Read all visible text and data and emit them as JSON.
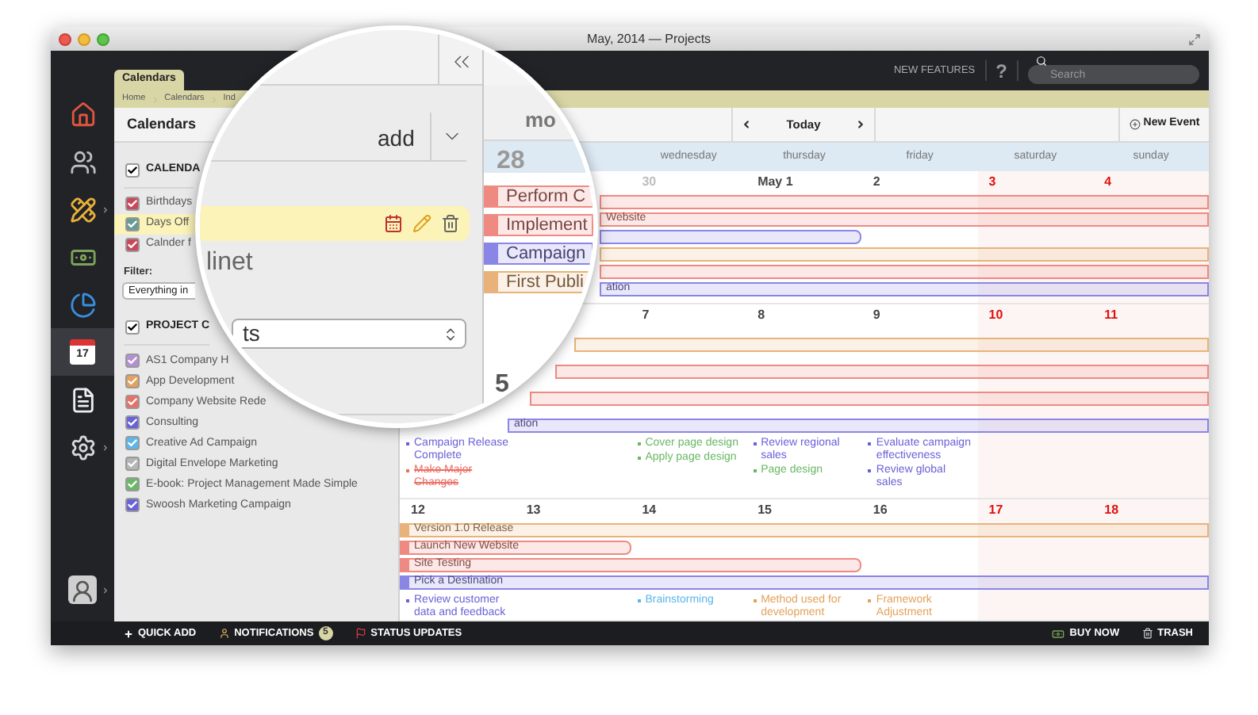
{
  "window": {
    "title": "May, 2014 — Projects"
  },
  "toolbar": {
    "new_features": "NEW FEATURES",
    "help": "?",
    "search": {
      "placeholder": "Search"
    }
  },
  "tabs": [
    {
      "label": "Calendars",
      "selected": true
    }
  ],
  "breadcrumb": [
    "Home",
    "Calendars",
    "Ind"
  ],
  "nav": [
    {
      "kind": "home",
      "selected": false,
      "has_menu": false
    },
    {
      "kind": "people",
      "selected": false,
      "has_menu": false
    },
    {
      "kind": "tools",
      "selected": false,
      "has_menu": true
    },
    {
      "kind": "money",
      "selected": false,
      "has_menu": false
    },
    {
      "kind": "chart",
      "selected": false,
      "has_menu": false
    },
    {
      "kind": "calendar",
      "selected": true,
      "has_menu": false,
      "label": "17"
    },
    {
      "kind": "document",
      "selected": false,
      "has_menu": false
    },
    {
      "kind": "settings",
      "selected": false,
      "has_menu": true
    }
  ],
  "user": {
    "has_menu": true
  },
  "panel": {
    "title": "Calendars",
    "calendars": {
      "title": "CALENDA",
      "checked": true,
      "items": [
        {
          "label": "Birthdays",
          "checked": true,
          "selected": false,
          "color": "#c9485b"
        },
        {
          "label": "Days Off",
          "checked": true,
          "selected": true,
          "color": "#6a9a96"
        },
        {
          "label": "Calnder f",
          "checked": true,
          "selected": false,
          "color": "#c9485b"
        }
      ]
    },
    "filter": {
      "label": "Filter:",
      "value": "Everything in"
    },
    "projects": {
      "title": "PROJECT C",
      "checked": true,
      "items": [
        {
          "label": "AS1 Company H",
          "checked": true,
          "color": "#b48fd6"
        },
        {
          "label": "App Development",
          "checked": true,
          "color": "#e4a15a"
        },
        {
          "label": "Company Website Rede",
          "checked": true,
          "color": "#ea6f66"
        },
        {
          "label": "Consulting",
          "checked": true,
          "color": "#6a62d8"
        },
        {
          "label": "Creative Ad Campaign",
          "checked": true,
          "color": "#5cb6ea"
        },
        {
          "label": "Digital Envelope Marketing",
          "checked": true,
          "color": "#b5b5b5"
        },
        {
          "label": "E-book: Project Management Made Simple",
          "checked": true,
          "color": "#6ab865"
        },
        {
          "label": "Swoosh Marketing Campaign",
          "checked": true,
          "color": "#6a62d8"
        }
      ]
    }
  },
  "calendar": {
    "today": "Today",
    "new_event": "New Event",
    "days": [
      {
        "label": "wednesday"
      },
      {
        "label": "thursday"
      },
      {
        "label": "friday"
      },
      {
        "label": "saturday"
      },
      {
        "label": "sunday"
      }
    ],
    "weeks": [
      {
        "cells": [
          {
            "date": "30",
            "weekend": false,
            "other_month": true
          },
          {
            "date": "May 1",
            "weekend": false,
            "other_month": false
          },
          {
            "date": "2",
            "weekend": false,
            "other_month": false
          },
          {
            "date": "3",
            "weekend": true,
            "other_month": false
          },
          {
            "date": "4",
            "weekend": true,
            "other_month": false
          }
        ],
        "events": [
          {
            "color": "#ee8a82",
            "kind": "full"
          },
          {
            "label": "Website",
            "color": "#ee8a82",
            "kind": "full"
          },
          {
            "color": "#8a86e6",
            "kind": "long"
          },
          {
            "color": "#e8b27a",
            "kind": "full"
          },
          {
            "color": "#ee8a82",
            "kind": "full"
          },
          {
            "label": "ation",
            "color": "#8a86e6",
            "kind": "full"
          }
        ]
      },
      {
        "cells": [
          {
            "weekend": false,
            "tasks": [
              {
                "text": "Campaign Release Complete",
                "color": "#6a62d8",
                "done": false
              },
              {
                "text": "Make Major Changes",
                "color": "#ea6f66",
                "done": true
              }
            ]
          },
          {
            "weekend": false
          },
          {
            "date": "7",
            "weekend": false,
            "other_month": false,
            "tasks": [
              {
                "text": "Cover page design",
                "color": "#6ab865",
                "done": false
              },
              {
                "text": "Apply page design",
                "color": "#6ab865",
                "done": false
              }
            ]
          },
          {
            "date": "8",
            "weekend": false,
            "other_month": false,
            "tasks": [
              {
                "text": "Review regional sales",
                "color": "#6a62d8",
                "done": false
              },
              {
                "text": "Page design",
                "color": "#6ab865",
                "done": false
              }
            ]
          },
          {
            "date": "9",
            "weekend": false,
            "other_month": false,
            "tasks": [
              {
                "text": "Evaluate campaign effectiveness",
                "color": "#6a62d8",
                "done": false
              },
              {
                "text": "Review global sales",
                "color": "#6a62d8",
                "done": false
              }
            ]
          },
          {
            "date": "10",
            "weekend": true,
            "other_month": false
          },
          {
            "date": "11",
            "weekend": true,
            "other_month": false
          }
        ],
        "events": [
          {
            "color": "#e8b27a",
            "kind": "full"
          },
          {
            "color": "#ee8a82",
            "kind": "full"
          },
          {
            "color": "#ee8a82",
            "kind": "full"
          },
          {
            "label": "ation",
            "color": "#8a86e6",
            "kind": "full"
          }
        ]
      },
      {
        "cells": [
          {
            "date": "12",
            "weekend": false,
            "other_month": false,
            "tasks": [
              {
                "text": "Review customer data and feedback",
                "color": "#6a62d8",
                "done": false
              }
            ]
          },
          {
            "date": "13",
            "weekend": false,
            "other_month": false
          },
          {
            "date": "14",
            "weekend": false,
            "other_month": false,
            "tasks": [
              {
                "text": "Brainstorming",
                "color": "#5cb6ea",
                "done": false
              }
            ]
          },
          {
            "date": "15",
            "weekend": false,
            "other_month": false,
            "tasks": [
              {
                "text": "Method used for development",
                "color": "#e4a15a",
                "done": false
              }
            ]
          },
          {
            "date": "16",
            "weekend": false,
            "other_month": false,
            "tasks": [
              {
                "text": "Framework Adjustment",
                "color": "#e4a15a",
                "done": false
              }
            ]
          },
          {
            "date": "17",
            "weekend": true,
            "other_month": false
          },
          {
            "date": "18",
            "weekend": true,
            "other_month": false
          }
        ],
        "events": [
          {
            "label": "Version 1.0 Release",
            "color": "#e8b27a",
            "kind": "full"
          },
          {
            "label": "Launch New Website",
            "color": "#ee8a82",
            "kind": "short"
          },
          {
            "label": "Site Testing",
            "color": "#ee8a82",
            "kind": "long"
          },
          {
            "label": "Pick a Destination",
            "color": "#8a86e6",
            "kind": "full"
          }
        ]
      }
    ]
  },
  "magnifier": {
    "add": "add",
    "text": "linet",
    "select_value": "ts",
    "month": "mo",
    "date": "28",
    "date_2": "5",
    "events": [
      {
        "label": "Perform C",
        "color": "#ee8a82"
      },
      {
        "label": "Implement",
        "color": "#ee8a82"
      },
      {
        "label": "Campaign",
        "color": "#8a86e6"
      },
      {
        "label": "First Publi",
        "color": "#e8b27a"
      }
    ]
  },
  "status_bar": {
    "quick_add": "QUICK ADD",
    "notifications": "NOTIFICATIONS",
    "notification_count": "5",
    "status_updates": "STATUS UPDATES",
    "buy_now": "BUY NOW",
    "trash": "TRASH"
  }
}
